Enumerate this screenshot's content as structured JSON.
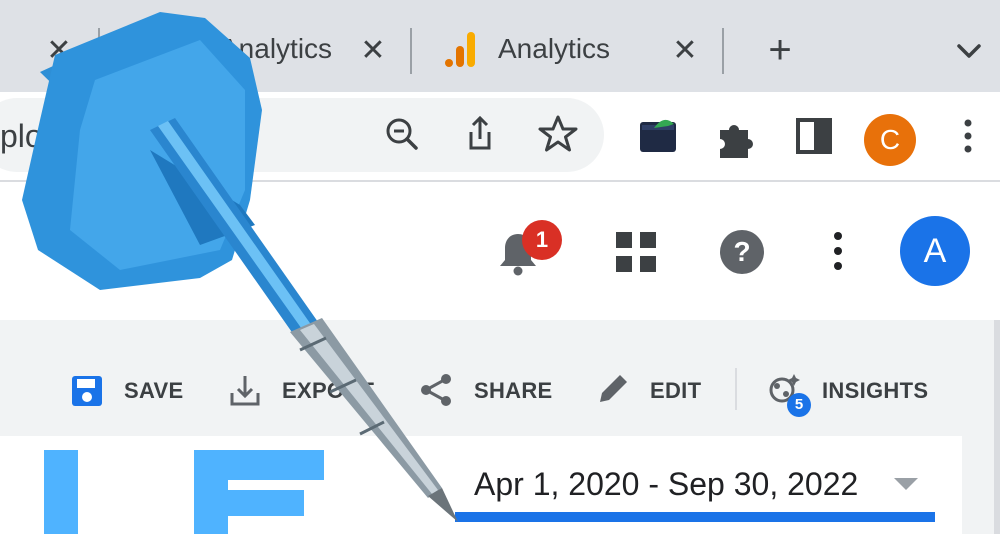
{
  "browser": {
    "tabs": [
      {
        "title": "Analytics",
        "active": false
      },
      {
        "title": "Analytics",
        "active": false
      }
    ],
    "new_tab_label": "+",
    "close_glyph": "✕",
    "omnibox_text": "plor… Keys…",
    "profile_initial": "C",
    "profile_color": "#e8710a",
    "toolbar_icons": [
      "zoom-out-icon",
      "share-icon",
      "bookmark-star-icon",
      "extension-app-icon",
      "puzzle-extensions-icon",
      "side-panel-icon",
      "kebab-menu-icon"
    ]
  },
  "header": {
    "notification_count": "1",
    "avatar_initial": "A",
    "avatar_color": "#1a73e8",
    "icons": [
      "bell-icon",
      "apps-grid-icon",
      "help-icon",
      "kebab-menu-icon"
    ]
  },
  "report": {
    "actions": {
      "save": "SAVE",
      "export": "EXPORT",
      "share": "SHARE",
      "edit": "EDIT",
      "insights": "INSIGHTS"
    },
    "insights_count": "5",
    "date_range": "Apr 1, 2020 - Sep 30, 2022",
    "accent_color": "#1a73e8",
    "hero_letter_color": "#4fb3ff"
  }
}
